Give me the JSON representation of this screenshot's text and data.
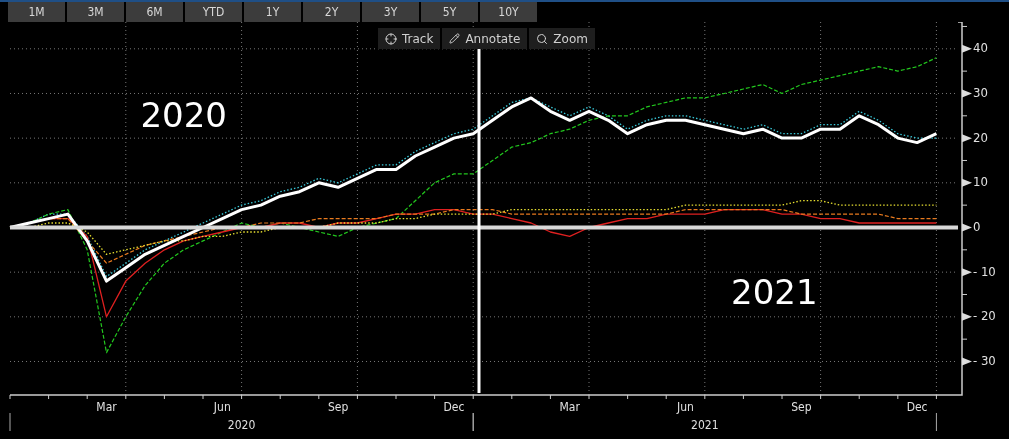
{
  "range_buttons": [
    "1M",
    "3M",
    "6M",
    "YTD",
    "1Y",
    "2Y",
    "3Y",
    "5Y",
    "10Y"
  ],
  "chart_tools": [
    {
      "kind": "track",
      "label": "Track"
    },
    {
      "kind": "annotate",
      "label": "Annotate"
    },
    {
      "kind": "zoom",
      "label": "Zoom"
    }
  ],
  "x_axis_years": [
    "2020",
    "2021"
  ],
  "chart_data": {
    "type": "line",
    "categories": [
      null,
      null,
      null,
      null,
      null,
      "Mar",
      null,
      null,
      null,
      null,
      null,
      "Jun",
      null,
      null,
      null,
      null,
      null,
      "Sep",
      null,
      null,
      null,
      null,
      null,
      "Dec",
      null,
      null,
      null,
      null,
      null,
      "Mar",
      null,
      null,
      null,
      null,
      null,
      "Jun",
      null,
      null,
      null,
      null,
      null,
      "Sep",
      null,
      null,
      null,
      null,
      null,
      "Dec",
      null
    ],
    "ylim": [
      -37.5,
      46
    ],
    "grid": true,
    "yticks": [
      -30,
      -20,
      -10,
      0,
      10,
      20,
      30,
      40
    ],
    "series": [
      {
        "color": "#ffffff",
        "line_style": "solid",
        "values": [
          0,
          1,
          2,
          3,
          -3,
          -12,
          -9,
          -6,
          -4,
          -2,
          0,
          2,
          4,
          5,
          7,
          8,
          10,
          9,
          11,
          13,
          13,
          16,
          18,
          20,
          21,
          24,
          27,
          29,
          26,
          24,
          26,
          24,
          21,
          23,
          24,
          24,
          23,
          22,
          21,
          22,
          20,
          20,
          22,
          22,
          25,
          23,
          20,
          19,
          21
        ]
      },
      {
        "color": "#38c8d8",
        "line_style": "dotted",
        "values": [
          0,
          1,
          3,
          3,
          -2,
          -11,
          -8,
          -5,
          -3,
          -1,
          1,
          3,
          5,
          6,
          8,
          9,
          11,
          10,
          12,
          14,
          14,
          17,
          19,
          21,
          22,
          25,
          28,
          29,
          27,
          25,
          27,
          25,
          22,
          24,
          25,
          25,
          24,
          23,
          22,
          23,
          21,
          21,
          23,
          23,
          26,
          24,
          21,
          20,
          20
        ]
      },
      {
        "color": "#22c81e",
        "line_style": "dashed",
        "values": [
          0,
          1,
          3,
          4,
          -5,
          -28,
          -20,
          -13,
          -8,
          -5,
          -3,
          -1,
          1,
          0,
          1,
          0,
          -1,
          -2,
          0,
          1,
          2,
          6,
          10,
          12,
          12,
          15,
          18,
          19,
          21,
          22,
          24,
          25,
          25,
          27,
          28,
          29,
          29,
          30,
          31,
          32,
          30,
          32,
          33,
          34,
          35,
          36,
          35,
          36,
          38
        ]
      },
      {
        "color": "#e02020",
        "line_style": "solid",
        "values": [
          0,
          1,
          2,
          2,
          -2,
          -20,
          -12,
          -8,
          -5,
          -3,
          -2,
          -1,
          0,
          0,
          1,
          1,
          0,
          1,
          1,
          2,
          3,
          3,
          4,
          4,
          3,
          3,
          2,
          1,
          -1,
          -2,
          0,
          1,
          2,
          2,
          3,
          3,
          3,
          4,
          4,
          4,
          3,
          3,
          2,
          2,
          1,
          1,
          1,
          1,
          1
        ]
      },
      {
        "color": "#e87a1e",
        "line_style": "dashed",
        "values": [
          0,
          1,
          2,
          2,
          -3,
          -8,
          -6,
          -4,
          -3,
          -2,
          -1,
          0,
          0,
          1,
          1,
          1,
          2,
          2,
          2,
          2,
          3,
          3,
          3,
          4,
          4,
          4,
          3,
          3,
          3,
          3,
          3,
          3,
          3,
          3,
          3,
          4,
          4,
          4,
          4,
          4,
          4,
          3,
          3,
          3,
          3,
          3,
          2,
          2,
          2
        ]
      },
      {
        "color": "#e8e030",
        "line_style": "dotted",
        "values": [
          0,
          0,
          1,
          1,
          -1,
          -6,
          -5,
          -4,
          -3,
          -3,
          -2,
          -2,
          -1,
          -1,
          0,
          0,
          0,
          1,
          1,
          1,
          2,
          2,
          3,
          3,
          3,
          3,
          4,
          4,
          4,
          4,
          4,
          4,
          4,
          4,
          4,
          5,
          5,
          5,
          5,
          5,
          5,
          6,
          6,
          5,
          5,
          5,
          5,
          5,
          5
        ]
      }
    ],
    "annotations": [
      "2020",
      "2021"
    ]
  }
}
